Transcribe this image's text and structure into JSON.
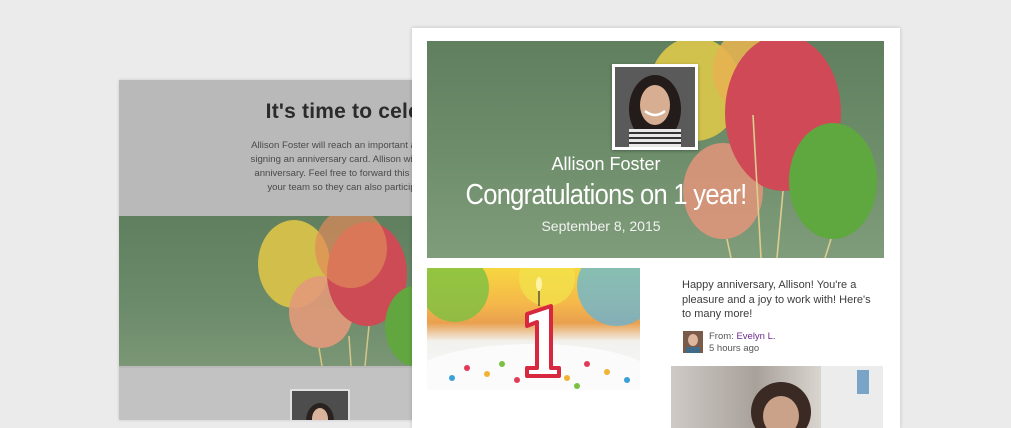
{
  "email": {
    "title": "It's time to celebrate",
    "body_lines": [
      "Allison Foster will reach an important anniversary soon. M",
      "signing an anniversary card. Allison will receive this card o",
      "anniversary. Feel free to forward this invitation to colleag",
      "your team so they can also participate in the celeb"
    ]
  },
  "hero": {
    "name": "Allison Foster",
    "congrats": "Congratulations on 1 year!",
    "date": "September 8, 2015"
  },
  "message": {
    "text": "Happy anniversary, Allison! You're a pleasure and a joy to work with! Here's to many more!",
    "from_label": "From: ",
    "sender": "Evelyn L.",
    "time": "5 hours ago"
  },
  "colors": {
    "background": "#ebebeb",
    "sender_link": "#6a2a8a"
  }
}
